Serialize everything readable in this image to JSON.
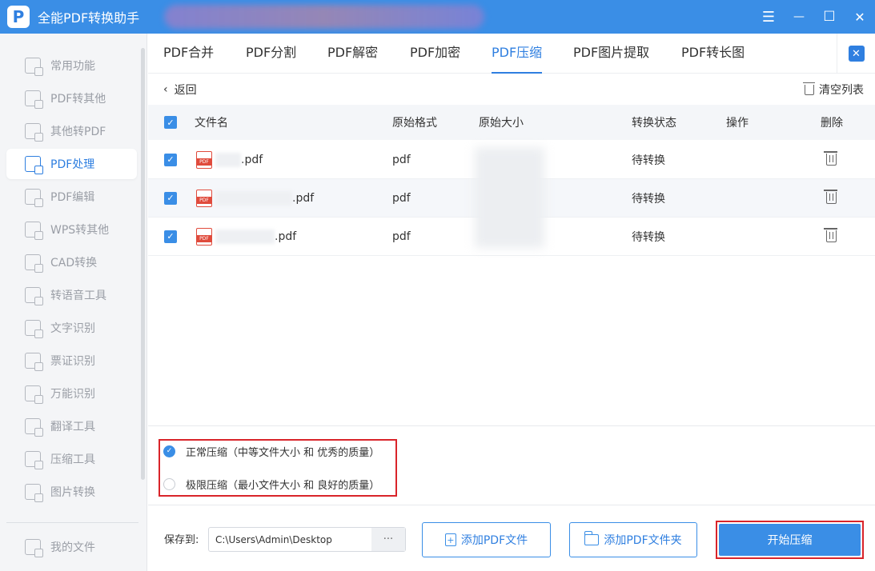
{
  "window": {
    "title": "全能PDF转换助手",
    "logo_letter": "P",
    "controls": {
      "menu": "☰",
      "minimize": "—",
      "maximize": "☐",
      "close": "✕"
    }
  },
  "sidebar": {
    "items": [
      {
        "label": "常用功能",
        "icon": "home-grid-icon"
      },
      {
        "label": "PDF转其他",
        "icon": "pdf-convert-icon"
      },
      {
        "label": "其他转PDF",
        "icon": "to-pdf-icon"
      },
      {
        "label": "PDF处理",
        "icon": "pdf-process-icon",
        "active": true
      },
      {
        "label": "PDF编辑",
        "icon": "pdf-edit-icon"
      },
      {
        "label": "WPS转其他",
        "icon": "wps-icon"
      },
      {
        "label": "CAD转换",
        "icon": "cad-icon"
      },
      {
        "label": "转语音工具",
        "icon": "voice-icon"
      },
      {
        "label": "文字识别",
        "icon": "ocr-icon"
      },
      {
        "label": "票证识别",
        "icon": "ticket-icon"
      },
      {
        "label": "万能识别",
        "icon": "universal-scan-icon"
      },
      {
        "label": "翻译工具",
        "icon": "translate-icon"
      },
      {
        "label": "压缩工具",
        "icon": "compress-icon"
      },
      {
        "label": "图片转换",
        "icon": "image-convert-icon"
      }
    ],
    "bottom_item": {
      "label": "我的文件",
      "icon": "my-files-icon"
    }
  },
  "tabs": [
    {
      "label": "PDF合并"
    },
    {
      "label": "PDF分割"
    },
    {
      "label": "PDF解密"
    },
    {
      "label": "PDF加密"
    },
    {
      "label": "PDF压缩",
      "active": true
    },
    {
      "label": "PDF图片提取"
    },
    {
      "label": "PDF转长图"
    }
  ],
  "close_panel_glyph": "✕",
  "toolbar": {
    "back_glyph": "‹",
    "back_label": "返回",
    "clear_label": "清空列表"
  },
  "table": {
    "headers": {
      "filename": "文件名",
      "format": "原始格式",
      "size": "原始大小",
      "status": "转换状态",
      "action": "操作",
      "delete": "删除"
    },
    "check_glyph": "✓",
    "rows": [
      {
        "name_suffix": ".pdf",
        "format": "pdf",
        "status": "待转换"
      },
      {
        "name_suffix": ".pdf",
        "format": "pdf",
        "status": "待转换"
      },
      {
        "name_suffix": ".pdf",
        "format": "pdf",
        "status": "待转换"
      }
    ]
  },
  "compression": {
    "options": [
      {
        "label": "正常压缩（中等文件大小 和 优秀的质量）",
        "selected": true
      },
      {
        "label": "极限压缩（最小文件大小 和 良好的质量）",
        "selected": false
      }
    ]
  },
  "footer": {
    "save_label": "保存到:",
    "save_path": "C:\\Users\\Admin\\Desktop",
    "more_glyph": "···",
    "add_file_label": "添加PDF文件",
    "add_folder_label": "添加PDF文件夹",
    "start_label": "开始压缩"
  },
  "colors": {
    "accent": "#3a8ee6",
    "highlight_box": "#d9242a",
    "pdf_red": "#e04b3c"
  }
}
